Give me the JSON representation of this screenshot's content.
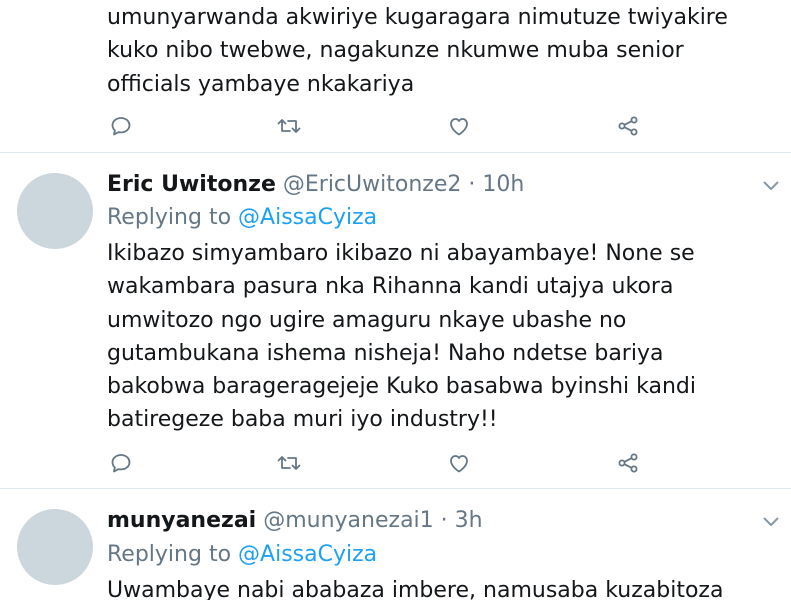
{
  "tweets": [
    {
      "text_lines": [
        "umunyarwanda akwiriye kugaragara nimutuze twiyakire",
        "kuko nibo twebwe, nagakunze nkumwe muba senior",
        "officials yambaye nkakariya"
      ]
    },
    {
      "name": "Eric Uwitonze",
      "handle": "@EricUwitonze2",
      "separator": "·",
      "time": "10h",
      "replying_prefix": "Replying to",
      "replying_to": "@AissaCyiza",
      "text_lines": [
        "Ikibazo simyambaro ikibazo ni abayambaye! None se",
        "wakambara pasura nka Rihanna kandi utajya ukora",
        "umwitozo ngo ugire amaguru nkaye ubashe no",
        "gutambukana ishema nisheja! Naho ndetse bariya",
        "bakobwa barageragejeje Kuko basabwa byinshi kandi",
        "batiregeze baba muri iyo industry!!"
      ]
    },
    {
      "name": "munyanezai",
      "handle": "@munyanezai1",
      "separator": "·",
      "time": "3h",
      "replying_prefix": "Replying to",
      "replying_to": "@AissaCyiza",
      "text_lines": [
        "Uwambaye nabi ababaza imbere, namusaba kuzabitoza"
      ]
    }
  ],
  "icons": {
    "reply": "reply-icon",
    "retweet": "retweet-icon",
    "like": "like-icon",
    "share": "share-icon",
    "menu": "chevron-down-icon"
  },
  "colors": {
    "text": "#14171a",
    "secondary": "#657786",
    "link": "#1da1f2",
    "avatar_placeholder": "#ccd6dd",
    "divider": "#e1e8ed"
  }
}
